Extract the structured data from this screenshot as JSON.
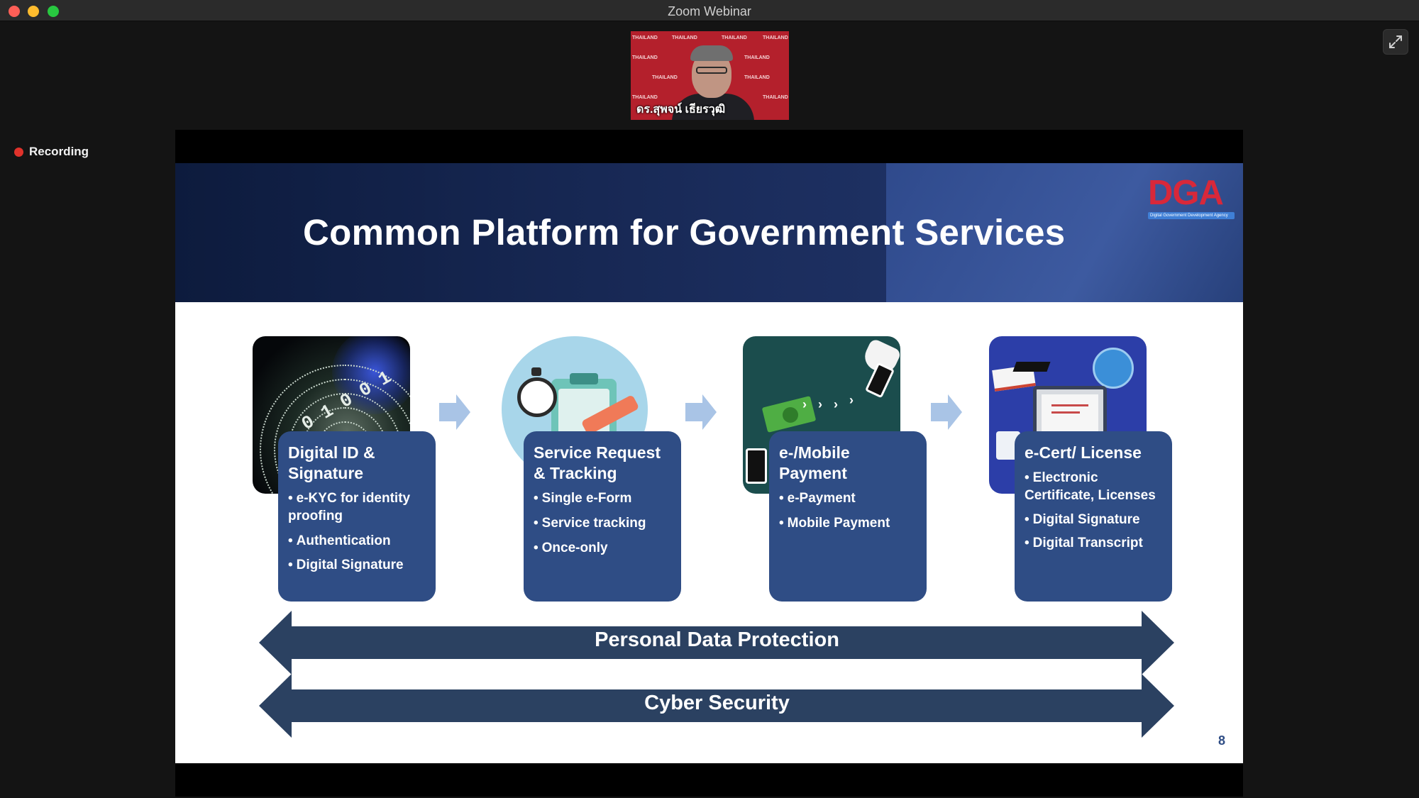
{
  "window": {
    "title": "Zoom Webinar"
  },
  "video": {
    "participant_name": "ดร.สุพจน์ เธียรวุฒิ",
    "backdrop_text": "THAILAND"
  },
  "status": {
    "recording_label": "Recording"
  },
  "slide": {
    "title": "Common Platform for Government Services",
    "logo_text": "DGA",
    "logo_subtitle": "Digital Government Development Agency",
    "cards": [
      {
        "title": "Digital ID & Signature",
        "items": [
          "e-KYC for identity proofing",
          "Authentication",
          "Digital Signature"
        ]
      },
      {
        "title": "Service Request & Tracking",
        "items": [
          "Single e-Form",
          "Service tracking",
          "Once-only"
        ]
      },
      {
        "title": "e-/Mobile Payment",
        "items": [
          "e-Payment",
          "Mobile Payment"
        ]
      },
      {
        "title": "e-Cert/ License",
        "items": [
          "Electronic Certificate, Licenses",
          "Digital Signature",
          "Digital Transcript"
        ]
      }
    ],
    "bands": [
      "Personal Data Protection",
      "Cyber Security"
    ],
    "page_number": "8",
    "binary_digits": "0 1 0 0 1",
    "colors": {
      "header_dark": "#0d1b3d",
      "card": "#2f4d85",
      "band": "#2b4161",
      "arrow": "#a9c4e6",
      "logo_red": "#d8283a"
    }
  }
}
